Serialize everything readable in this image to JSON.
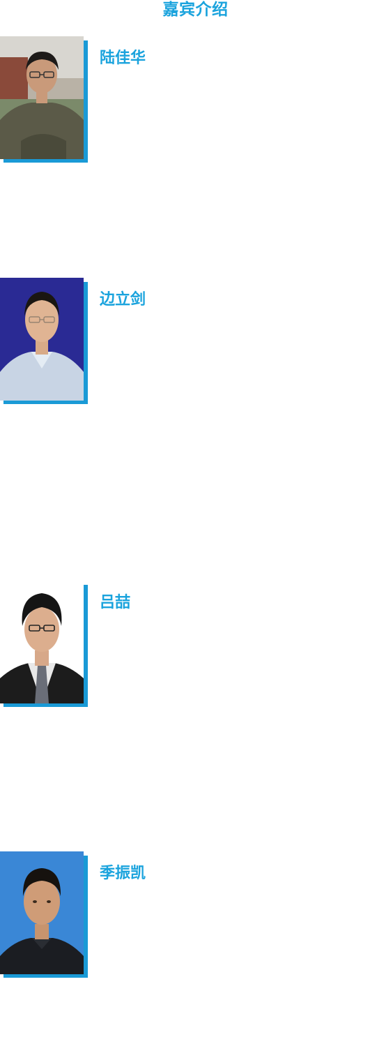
{
  "section": {
    "title": "嘉宾介绍"
  },
  "speakers": [
    {
      "name": "陆佳华",
      "photo": "speaker-portrait"
    },
    {
      "name": "边立剑",
      "photo": "speaker-portrait"
    },
    {
      "name": "吕喆",
      "photo": "speaker-portrait"
    },
    {
      "name": "季振凯",
      "photo": "speaker-portrait"
    }
  ],
  "colors": {
    "accent": "#1aa3dd",
    "photo_border": "#1a9ad6"
  }
}
